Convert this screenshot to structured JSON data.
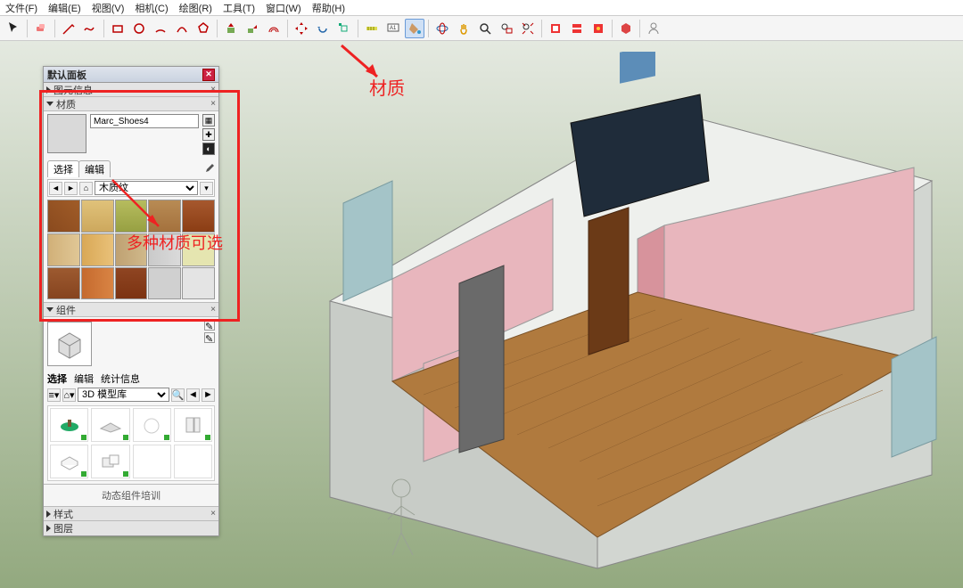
{
  "menu": {
    "items": [
      "文件(F)",
      "编辑(E)",
      "视图(V)",
      "相机(C)",
      "绘图(R)",
      "工具(T)",
      "窗口(W)",
      "帮助(H)"
    ]
  },
  "toolbar": {
    "activeIndex": 17
  },
  "tray": {
    "title": "默认面板",
    "sections": {
      "entity": "图元信息",
      "materials": "材质",
      "components": "组件",
      "dynamic": "动态组件培训",
      "styles": "样式",
      "layers": "图层"
    }
  },
  "materials": {
    "name": "Marc_Shoes4",
    "tabs": {
      "select": "选择",
      "edit": "编辑"
    },
    "category": "木质纹",
    "swatchCount": 15
  },
  "components": {
    "tabs": {
      "select": "选择",
      "edit": "编辑",
      "stats": "统计信息"
    },
    "library": "3D 模型库"
  },
  "annotations": {
    "material_label": "材质",
    "multi_material": "多种材质可选"
  }
}
